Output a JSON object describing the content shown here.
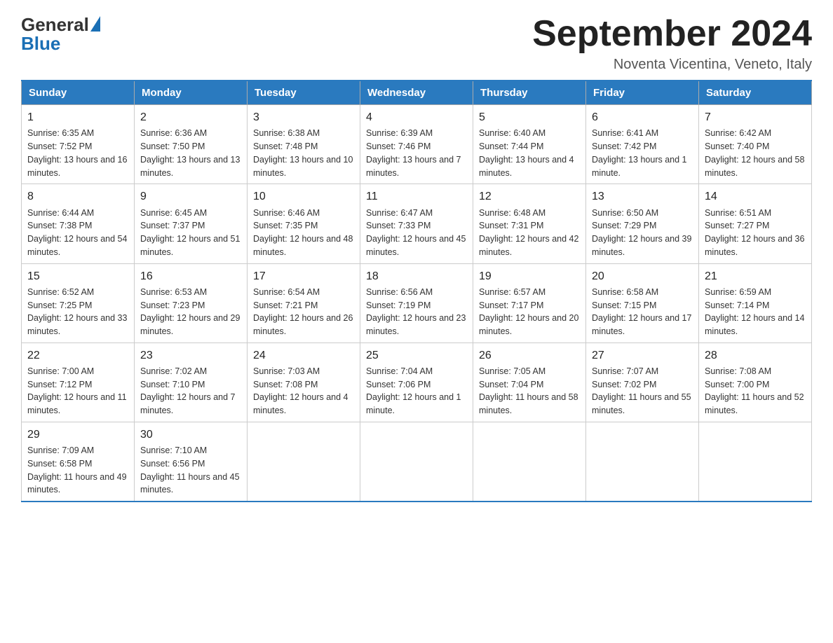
{
  "header": {
    "logo_general": "General",
    "logo_blue": "Blue",
    "month_title": "September 2024",
    "subtitle": "Noventa Vicentina, Veneto, Italy"
  },
  "days_of_week": [
    "Sunday",
    "Monday",
    "Tuesday",
    "Wednesday",
    "Thursday",
    "Friday",
    "Saturday"
  ],
  "weeks": [
    [
      {
        "num": "1",
        "sunrise": "6:35 AM",
        "sunset": "7:52 PM",
        "daylight": "13 hours and 16 minutes."
      },
      {
        "num": "2",
        "sunrise": "6:36 AM",
        "sunset": "7:50 PM",
        "daylight": "13 hours and 13 minutes."
      },
      {
        "num": "3",
        "sunrise": "6:38 AM",
        "sunset": "7:48 PM",
        "daylight": "13 hours and 10 minutes."
      },
      {
        "num": "4",
        "sunrise": "6:39 AM",
        "sunset": "7:46 PM",
        "daylight": "13 hours and 7 minutes."
      },
      {
        "num": "5",
        "sunrise": "6:40 AM",
        "sunset": "7:44 PM",
        "daylight": "13 hours and 4 minutes."
      },
      {
        "num": "6",
        "sunrise": "6:41 AM",
        "sunset": "7:42 PM",
        "daylight": "13 hours and 1 minute."
      },
      {
        "num": "7",
        "sunrise": "6:42 AM",
        "sunset": "7:40 PM",
        "daylight": "12 hours and 58 minutes."
      }
    ],
    [
      {
        "num": "8",
        "sunrise": "6:44 AM",
        "sunset": "7:38 PM",
        "daylight": "12 hours and 54 minutes."
      },
      {
        "num": "9",
        "sunrise": "6:45 AM",
        "sunset": "7:37 PM",
        "daylight": "12 hours and 51 minutes."
      },
      {
        "num": "10",
        "sunrise": "6:46 AM",
        "sunset": "7:35 PM",
        "daylight": "12 hours and 48 minutes."
      },
      {
        "num": "11",
        "sunrise": "6:47 AM",
        "sunset": "7:33 PM",
        "daylight": "12 hours and 45 minutes."
      },
      {
        "num": "12",
        "sunrise": "6:48 AM",
        "sunset": "7:31 PM",
        "daylight": "12 hours and 42 minutes."
      },
      {
        "num": "13",
        "sunrise": "6:50 AM",
        "sunset": "7:29 PM",
        "daylight": "12 hours and 39 minutes."
      },
      {
        "num": "14",
        "sunrise": "6:51 AM",
        "sunset": "7:27 PM",
        "daylight": "12 hours and 36 minutes."
      }
    ],
    [
      {
        "num": "15",
        "sunrise": "6:52 AM",
        "sunset": "7:25 PM",
        "daylight": "12 hours and 33 minutes."
      },
      {
        "num": "16",
        "sunrise": "6:53 AM",
        "sunset": "7:23 PM",
        "daylight": "12 hours and 29 minutes."
      },
      {
        "num": "17",
        "sunrise": "6:54 AM",
        "sunset": "7:21 PM",
        "daylight": "12 hours and 26 minutes."
      },
      {
        "num": "18",
        "sunrise": "6:56 AM",
        "sunset": "7:19 PM",
        "daylight": "12 hours and 23 minutes."
      },
      {
        "num": "19",
        "sunrise": "6:57 AM",
        "sunset": "7:17 PM",
        "daylight": "12 hours and 20 minutes."
      },
      {
        "num": "20",
        "sunrise": "6:58 AM",
        "sunset": "7:15 PM",
        "daylight": "12 hours and 17 minutes."
      },
      {
        "num": "21",
        "sunrise": "6:59 AM",
        "sunset": "7:14 PM",
        "daylight": "12 hours and 14 minutes."
      }
    ],
    [
      {
        "num": "22",
        "sunrise": "7:00 AM",
        "sunset": "7:12 PM",
        "daylight": "12 hours and 11 minutes."
      },
      {
        "num": "23",
        "sunrise": "7:02 AM",
        "sunset": "7:10 PM",
        "daylight": "12 hours and 7 minutes."
      },
      {
        "num": "24",
        "sunrise": "7:03 AM",
        "sunset": "7:08 PM",
        "daylight": "12 hours and 4 minutes."
      },
      {
        "num": "25",
        "sunrise": "7:04 AM",
        "sunset": "7:06 PM",
        "daylight": "12 hours and 1 minute."
      },
      {
        "num": "26",
        "sunrise": "7:05 AM",
        "sunset": "7:04 PM",
        "daylight": "11 hours and 58 minutes."
      },
      {
        "num": "27",
        "sunrise": "7:07 AM",
        "sunset": "7:02 PM",
        "daylight": "11 hours and 55 minutes."
      },
      {
        "num": "28",
        "sunrise": "7:08 AM",
        "sunset": "7:00 PM",
        "daylight": "11 hours and 52 minutes."
      }
    ],
    [
      {
        "num": "29",
        "sunrise": "7:09 AM",
        "sunset": "6:58 PM",
        "daylight": "11 hours and 49 minutes."
      },
      {
        "num": "30",
        "sunrise": "7:10 AM",
        "sunset": "6:56 PM",
        "daylight": "11 hours and 45 minutes."
      },
      null,
      null,
      null,
      null,
      null
    ]
  ]
}
